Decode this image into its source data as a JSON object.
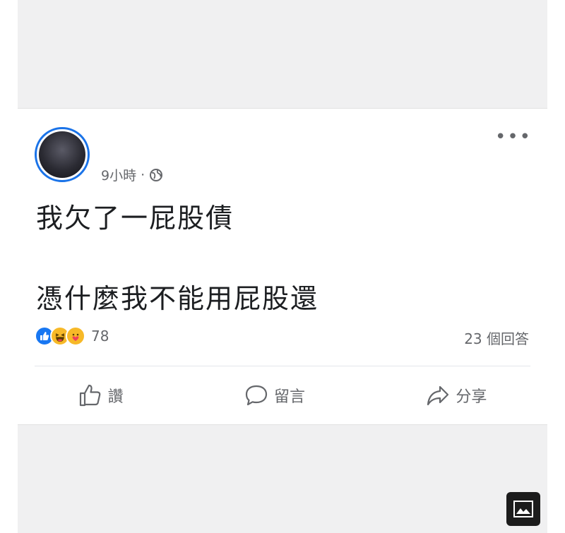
{
  "post": {
    "time_label": "9小時",
    "separator": "·",
    "body_line1": "我欠了一屁股債",
    "body_line2": "憑什麼我不能用屁股還",
    "reaction_count": "78",
    "comment_count": "23 個回答"
  },
  "actions": {
    "like_label": "讚",
    "comment_label": "留言",
    "share_label": "分享"
  },
  "icons": {
    "more": "more-dots-icon",
    "privacy": "globe-icon",
    "reaction1": "like-reaction-icon",
    "reaction2": "haha-reaction-icon",
    "reaction3": "care-reaction-icon",
    "like": "thumbs-up-icon",
    "comment": "speech-bubble-icon",
    "share": "share-arrow-icon",
    "image_badge": "image-icon"
  },
  "colors": {
    "accent": "#1877f2",
    "avatar_ring": "#1a73e8",
    "secondary_text": "#65676b",
    "primary_text": "#1c1e21"
  }
}
